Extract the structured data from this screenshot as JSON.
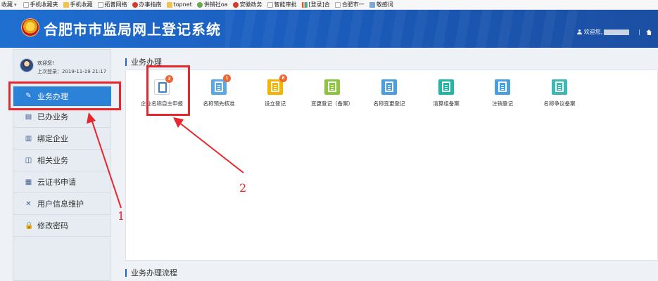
{
  "bookmarks": [
    {
      "label": "收藏",
      "icon": "page"
    },
    {
      "label": "手机收藏夹",
      "icon": "folder"
    },
    {
      "label": "手机收藏",
      "icon": "folder"
    },
    {
      "label": "拓普网络",
      "icon": "page"
    },
    {
      "label": "办事指南",
      "icon": "red"
    },
    {
      "label": "topnet",
      "icon": "folder"
    },
    {
      "label": "供销社oa",
      "icon": "green"
    },
    {
      "label": "安徽政务",
      "icon": "red"
    },
    {
      "label": "智能审批",
      "icon": "page"
    },
    {
      "label": "[登录]合",
      "icon": "grid"
    },
    {
      "label": "合肥市一",
      "icon": "page"
    },
    {
      "label": "敬感词",
      "icon": "img"
    }
  ],
  "header": {
    "title": "合肥市市监局网上登记系统",
    "greeting": "欢迎您,",
    "separator": "|"
  },
  "sidebar": {
    "welcome": "欢迎您!",
    "last_login": "上次登录：2019-11-19 21:17",
    "items": [
      {
        "label": "业务办理",
        "icon": "✎",
        "active": true
      },
      {
        "label": "已办业务",
        "icon": "▤"
      },
      {
        "label": "绑定企业",
        "icon": "▥"
      },
      {
        "label": "相关业务",
        "icon": "◫"
      },
      {
        "label": "云证书申请",
        "icon": "▦"
      },
      {
        "label": "用户信息维护",
        "icon": "✕"
      },
      {
        "label": "修改密码",
        "icon": "🔒"
      }
    ]
  },
  "main": {
    "section1_title": "业务办理",
    "section2_title": "业务办理流程",
    "services": [
      {
        "label": "企业名称自主申报",
        "color": "#ffffff",
        "badge": "3"
      },
      {
        "label": "名称预先核准",
        "color": "#5aa9e6",
        "badge": "1"
      },
      {
        "label": "设立登记",
        "color": "#f5b400",
        "badge": "8"
      },
      {
        "label": "变更登记（备案）",
        "color": "#8cc63f",
        "badge": ""
      },
      {
        "label": "名称变更登记",
        "color": "#4a9fe0",
        "badge": ""
      },
      {
        "label": "清算组备案",
        "color": "#20b7a6",
        "badge": ""
      },
      {
        "label": "注销登记",
        "color": "#4a9fe0",
        "badge": ""
      },
      {
        "label": "名称争议备案",
        "color": "#3fb8b4",
        "badge": ""
      }
    ]
  },
  "annotations": {
    "label_1": "1",
    "label_2": "2",
    "color": "#e8262d"
  }
}
